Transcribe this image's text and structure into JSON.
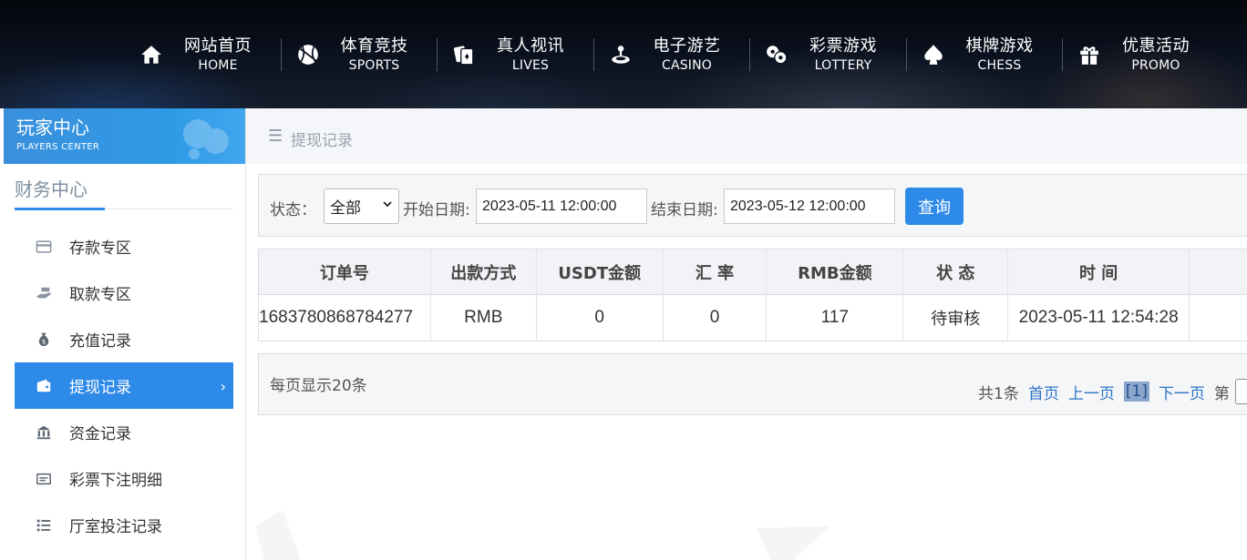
{
  "nav": [
    {
      "cn": "网站首页",
      "en": "HOME",
      "icon": "home-icon"
    },
    {
      "cn": "体育竞技",
      "en": "SPORTS",
      "icon": "basketball-icon"
    },
    {
      "cn": "真人视讯",
      "en": "LIVES",
      "icon": "playing-cards-icon"
    },
    {
      "cn": "电子游艺",
      "en": "CASINO",
      "icon": "joystick-icon"
    },
    {
      "cn": "彩票游戏",
      "en": "LOTTERY",
      "icon": "lottery-balls-icon"
    },
    {
      "cn": "棋牌游戏",
      "en": "CHESS",
      "icon": "spade-icon"
    },
    {
      "cn": "优惠活动",
      "en": "PROMO",
      "icon": "gift-icon"
    }
  ],
  "sidebar": {
    "title": "玩家中心",
    "subtitle": "PLAYERS CENTER",
    "section": "财务中心",
    "items": [
      {
        "label": "存款专区",
        "icon": "card-icon"
      },
      {
        "label": "取款专区",
        "icon": "cash-hand-icon"
      },
      {
        "label": "充值记录",
        "icon": "money-bag-icon"
      },
      {
        "label": "提现记录",
        "icon": "wallet-icon",
        "active": true
      },
      {
        "label": "资金记录",
        "icon": "bank-icon"
      },
      {
        "label": "彩票下注明细",
        "icon": "ticket-icon"
      },
      {
        "label": "厅室投注记录",
        "icon": "list-icon"
      }
    ]
  },
  "breadcrumb": "提现记录",
  "filter": {
    "status_label": "状态：",
    "status_value": "全部",
    "start_label": "开始日期:",
    "start_value": "2023-05-11 12:00:00",
    "end_label": "结束日期:",
    "end_value": "2023-05-12 12:00:00",
    "search_button": "查询"
  },
  "table": {
    "headers": [
      "订单号",
      "出款方式",
      "USDT金额",
      "汇 率",
      "RMB金额",
      "状 态",
      "时 间",
      ""
    ],
    "rows": [
      [
        "1683780868784277",
        "RMB",
        "0",
        "0",
        "117",
        "待审核",
        "2023-05-11 12:54:28",
        ""
      ]
    ]
  },
  "pager": {
    "per_page": "每页显示20条",
    "total": "共1条",
    "first": "首页",
    "prev": "上一页",
    "current": "[1]",
    "next": "下一页",
    "goto": "第"
  },
  "colors": {
    "accent": "#2d8ae8",
    "header_bg": "#0b1220"
  }
}
